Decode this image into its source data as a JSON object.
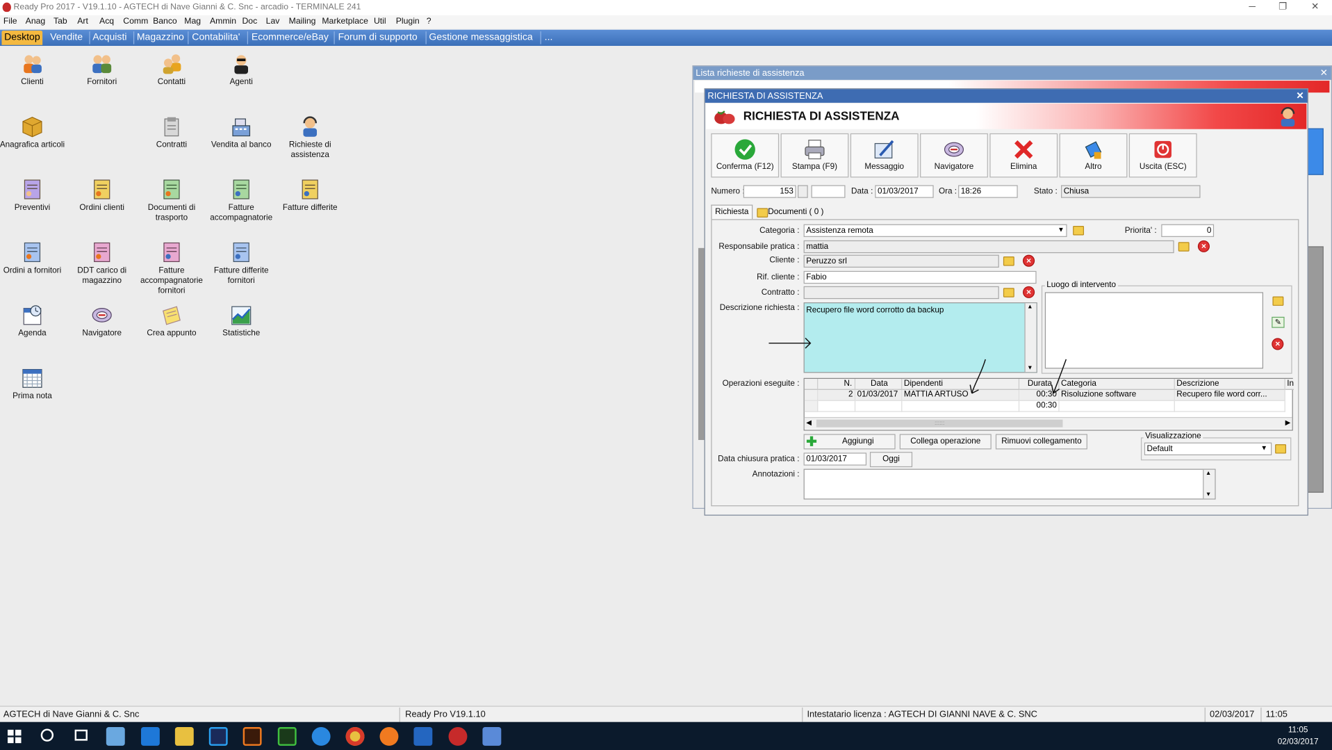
{
  "window": {
    "title": "Ready Pro 2017 - V19.1.10 - AGTECH di Nave Gianni & C. Snc - arcadio - TERMINALE 241",
    "controls": [
      "─",
      "❐",
      "✕"
    ]
  },
  "menubar": [
    "File",
    "Anag",
    "Tab",
    "Art",
    "Acq",
    "Comm",
    "Banco",
    "Mag",
    "Ammin",
    "Doc",
    "Lav",
    "Mailing",
    "Marketplace",
    "Util",
    "Plugin",
    "?"
  ],
  "tabs": [
    "Desktop",
    "Vendite",
    "Acquisti",
    "Magazzino",
    "Contabilita'",
    "Ecommerce/eBay",
    "Forum di supporto",
    "Gestione messaggistica",
    "..."
  ],
  "desktop_icons": [
    {
      "label": "Clienti",
      "icon": "clients-icon"
    },
    {
      "label": "Fornitori",
      "icon": "suppliers-icon"
    },
    {
      "label": "Contatti",
      "icon": "contacts-icon"
    },
    {
      "label": "Agenti",
      "icon": "agents-icon"
    },
    {
      "label": "Anagrafica articoli",
      "icon": "articles-icon"
    },
    {
      "label": "Contratti",
      "icon": "contracts-icon"
    },
    {
      "label": "Vendita al banco",
      "icon": "cash-register-icon"
    },
    {
      "label": "Richieste di assistenza",
      "icon": "support-requests-icon"
    },
    {
      "label": "Preventivi",
      "icon": "quotes-icon"
    },
    {
      "label": "Ordini clienti",
      "icon": "customer-orders-icon"
    },
    {
      "label": "Documenti di trasporto",
      "icon": "transport-docs-icon"
    },
    {
      "label": "Fatture accompagnatorie",
      "icon": "invoices-icon"
    },
    {
      "label": "Fatture differite",
      "icon": "deferred-invoices-icon"
    },
    {
      "label": "Ordini a fornitori",
      "icon": "supplier-orders-icon"
    },
    {
      "label": "DDT carico di magazzino",
      "icon": "warehouse-load-icon"
    },
    {
      "label": "Fatture accompagnatorie fornitori",
      "icon": "supplier-invoices-icon"
    },
    {
      "label": "Fatture differite fornitori",
      "icon": "supplier-deferred-invoices-icon"
    },
    {
      "label": "Agenda",
      "icon": "agenda-icon"
    },
    {
      "label": "Navigatore",
      "icon": "navigator-icon"
    },
    {
      "label": "Crea appunto",
      "icon": "note-icon"
    },
    {
      "label": "Statistiche",
      "icon": "statistics-icon"
    },
    {
      "label": "Prima nota",
      "icon": "calendar-icon"
    }
  ],
  "list_window": {
    "title": "Lista richieste di assistenza",
    "close": "✕"
  },
  "request_window": {
    "title": "RICHIESTA DI ASSISTENZA",
    "header": "RICHIESTA DI ASSISTENZA",
    "close": "✕",
    "toolbar": [
      {
        "label": "Conferma (F12)",
        "icon": "check-icon"
      },
      {
        "label": "Stampa (F9)",
        "icon": "printer-icon"
      },
      {
        "label": "Messaggio",
        "icon": "message-icon"
      },
      {
        "label": "Navigatore",
        "icon": "navigator-icon"
      },
      {
        "label": "Elimina",
        "icon": "delete-icon"
      },
      {
        "label": "Altro",
        "icon": "other-icon"
      },
      {
        "label": "Uscita (ESC)",
        "icon": "exit-icon"
      }
    ],
    "numero_label": "Numero :",
    "numero": "153",
    "data_label": "Data :",
    "data": "01/03/2017",
    "ora_label": "Ora :",
    "ora": "18:26",
    "stato_label": "Stato :",
    "stato": "Chiusa",
    "subtabs": [
      "Richiesta",
      "Documenti ( 0 )"
    ],
    "categoria_label": "Categoria :",
    "categoria": "Assistenza remota",
    "priorita_label": "Priorita' :",
    "priorita": "0",
    "responsabile_label": "Responsabile pratica :",
    "responsabile": "mattia",
    "cliente_label": "Cliente :",
    "cliente": "Peruzzo srl",
    "rif_label": "Rif. cliente :",
    "rif": "Fabio",
    "contratto_label": "Contratto :",
    "contratto": "",
    "descrizione_label": "Descrizione richiesta :",
    "descrizione": "Recupero file word corrotto da backup",
    "luogo_label": "Luogo di intervento",
    "operazioni_label": "Operazioni eseguite :",
    "grid_headers": [
      "N.",
      "Data",
      "Dipendenti",
      "Durata",
      "Categoria",
      "Descrizione",
      "In"
    ],
    "grid_rows": [
      [
        "2",
        "01/03/2017",
        "MATTIA ARTUSO",
        "00:30",
        "Risoluzione software",
        "Recupero file word corr..."
      ],
      [
        "",
        "",
        "",
        "00:30",
        "",
        ""
      ]
    ],
    "scroll_grip": "::::::",
    "aggiungi": "Aggiungi",
    "collega": "Collega operazione",
    "rimuovi": "Rimuovi collegamento",
    "visualizzazione_label": "Visualizzazione",
    "visualizzazione": "Default",
    "chiusura_label": "Data chiusura pratica :",
    "chiusura": "01/03/2017",
    "oggi": "Oggi",
    "annotazioni_label": "Annotazioni :"
  },
  "statusbar": {
    "company": "AGTECH di Nave Gianni & C. Snc",
    "version": "Ready Pro V19.1.10",
    "license": "Intestatario licenza : AGTECH DI GIANNI NAVE & C. SNC",
    "date": "02/03/2017",
    "time": "11:05"
  },
  "taskbar": {
    "time": "11:05",
    "date": "02/03/2017"
  },
  "colors": {
    "accent": "#3b6fb8",
    "active_tab": "#f4b940",
    "description_bg": "#b3ecee",
    "header_red": "#e32828"
  }
}
